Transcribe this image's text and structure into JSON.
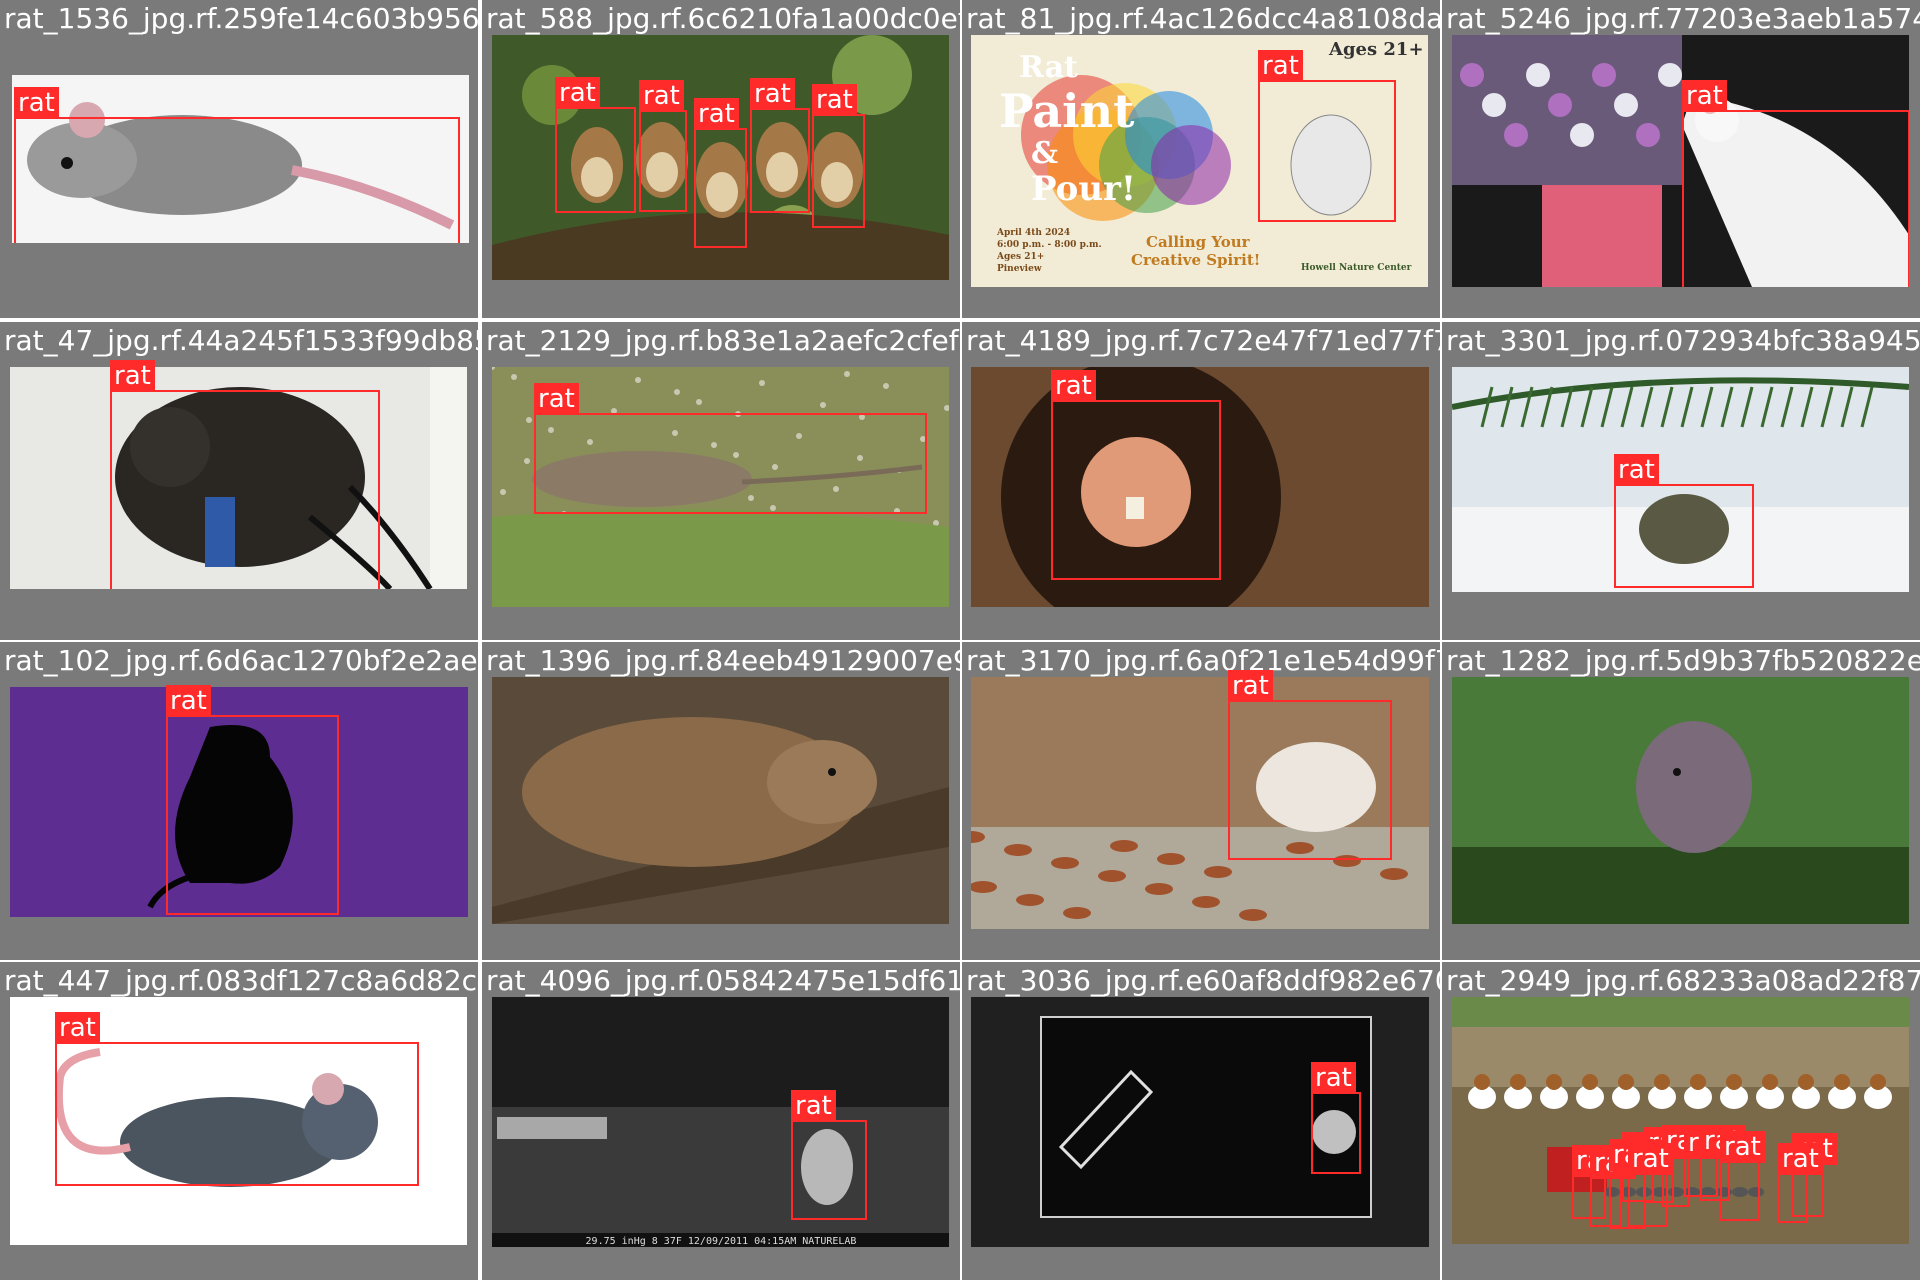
{
  "label": "rat",
  "images": [
    {
      "filename": "rat_1536_jpg.rf.259fe14c603b9565aefe59898",
      "box_labels": [
        "rat"
      ]
    },
    {
      "filename": "rat_588_jpg.rf.6c6210fa1a00dc0ef1a807d2",
      "box_labels": [
        "rat",
        "rat",
        "rat",
        "rat",
        "rat"
      ]
    },
    {
      "filename": "rat_81_jpg.rf.4ac126dcc4a8108da6af5496a2",
      "box_labels": [
        "rat"
      ]
    },
    {
      "filename": "rat_5246_jpg.rf.77203e3aeb1a574",
      "box_labels": [
        "rat"
      ]
    },
    {
      "filename": "rat_47_jpg.rf.44a245f1533f99db85a1a92445",
      "box_labels": [
        "rat"
      ]
    },
    {
      "filename": "rat_2129_jpg.rf.b83e1a2aefc2cfefe4637569",
      "box_labels": [
        "rat"
      ]
    },
    {
      "filename": "rat_4189_jpg.rf.7c72e47f71ed77f7752a5501f",
      "box_labels": [
        "rat"
      ]
    },
    {
      "filename": "rat_3301_jpg.rf.072934bfc38a9453",
      "box_labels": [
        "rat"
      ]
    },
    {
      "filename": "rat_102_jpg.rf.6d6ac1270bf2e2aeb810456d8",
      "box_labels": [
        "rat"
      ]
    },
    {
      "filename": "rat_1396_jpg.rf.84eeb49129007e9d0696d1f6",
      "box_labels": []
    },
    {
      "filename": "rat_3170_jpg.rf.6a0f21e1e54d99f75a1f9257",
      "box_labels": [
        "rat"
      ]
    },
    {
      "filename": "rat_1282_jpg.rf.5d9b37fb520822e",
      "box_labels": []
    },
    {
      "filename": "rat_447_jpg.rf.083df127c8a6d82c5fd961bb",
      "box_labels": [
        "rat"
      ]
    },
    {
      "filename": "rat_4096_jpg.rf.05842475e15df614264000896",
      "box_labels": [
        "rat"
      ]
    },
    {
      "filename": "rat_3036_jpg.rf.e60af8ddf982e670a9c124422",
      "box_labels": [
        "rat"
      ]
    },
    {
      "filename": "rat_2949_jpg.rf.68233a08ad22f87",
      "box_labels": [
        "rat",
        "rat",
        "rat",
        "rat",
        "rat",
        "rat",
        "rat",
        "rat",
        "rat",
        "rat",
        "rat",
        "rat"
      ]
    }
  ],
  "poster": {
    "title1": "Rat",
    "title2": "Paint",
    "amp": "&",
    "title3": "Pour!",
    "ages": "Ages 21+",
    "date": "April 4th 2024",
    "time": "6:00 p.m. - 8:00 p.m.",
    "agesline": "Ages 21+",
    "place": "Pineview",
    "slogan1": "Calling Your",
    "slogan2": "Creative Spirit!",
    "org": "Howell Nature Center"
  },
  "camera_overlay_1": "29.75 inHg  8 37F  12/09/2011 04:15AM NATURELAB",
  "scene_colors": [
    "#f5f5f5",
    "#3f5a28",
    "#f2ecd6",
    "#1a1a1a",
    "#dfe3e6",
    "#8a8f5a",
    "#6b4a30",
    "#dfe7ec",
    "#5e2d91",
    "#5a4a3a",
    "#9a7a5a",
    "#4a7a3a",
    "#ffffff",
    "#1c1c1c",
    "#202020",
    "#9a8a6a"
  ],
  "box_color": "#ff2a2a"
}
